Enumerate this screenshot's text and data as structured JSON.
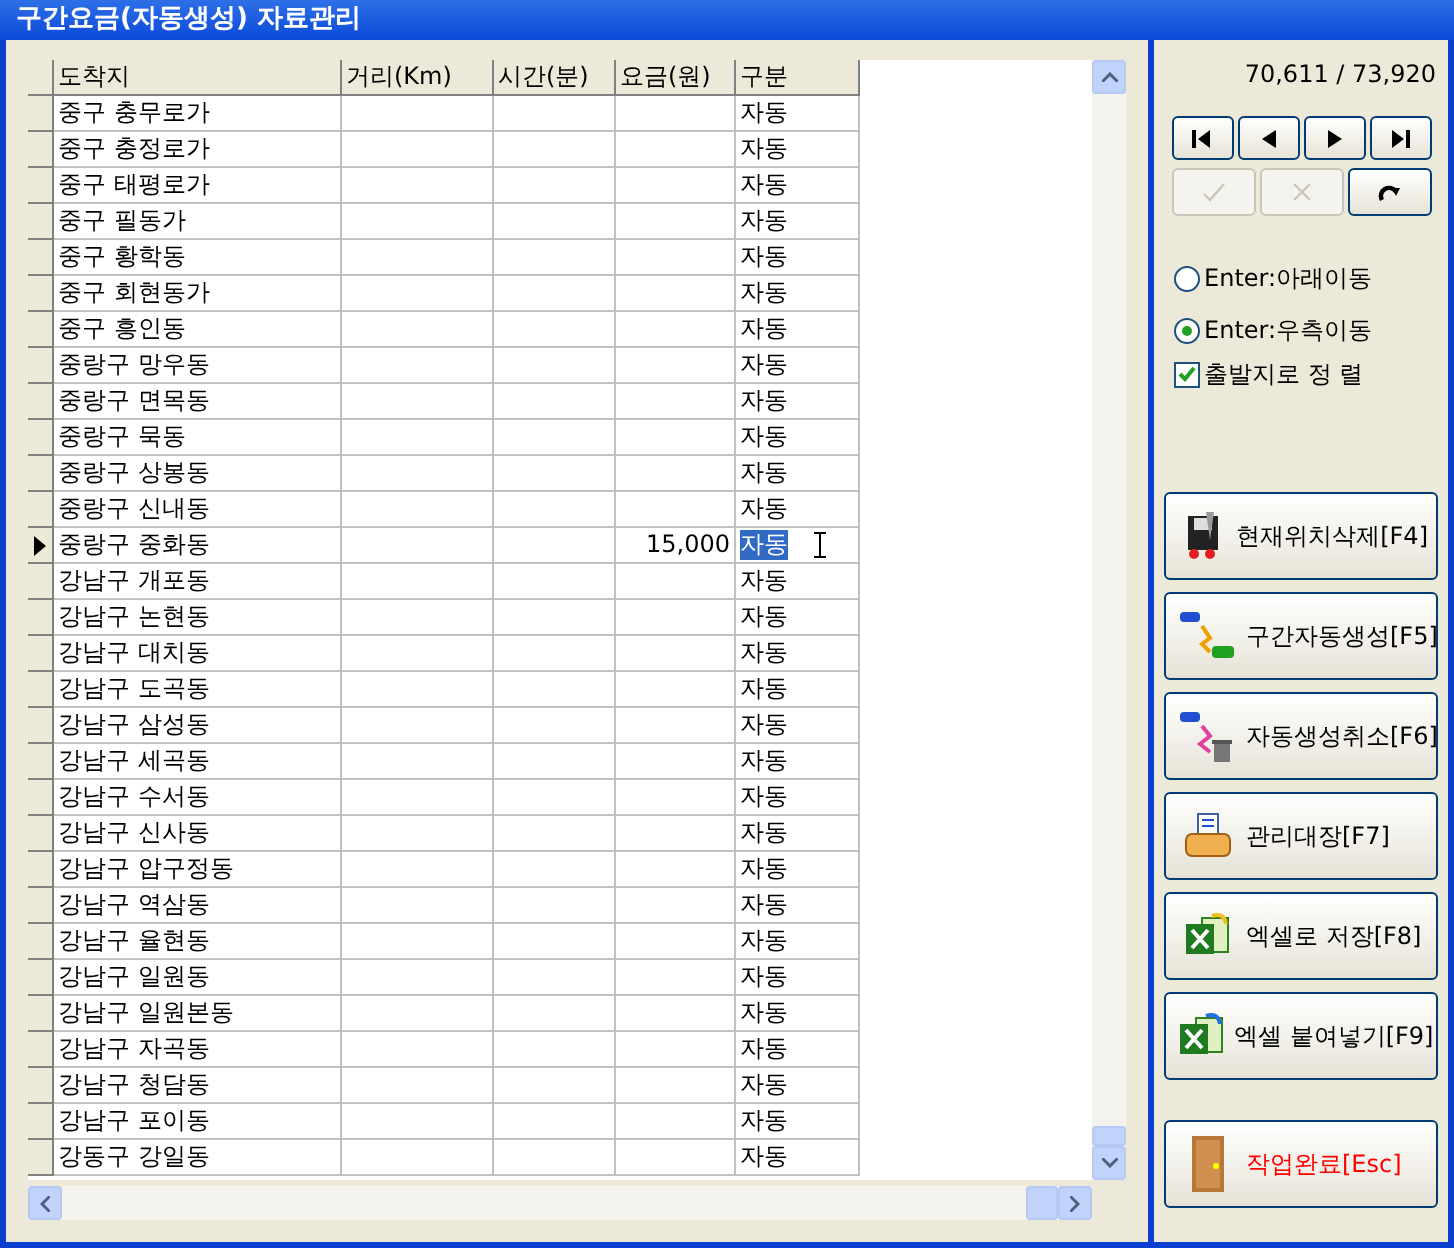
{
  "window": {
    "title": "구간요금(자동생성) 자료관리"
  },
  "table": {
    "columns": [
      "도착지",
      "거리(Km)",
      "시간(분)",
      "요금(원)",
      "구분"
    ],
    "rows": [
      {
        "cells": [
          "중구 충무로가",
          "",
          "",
          "",
          "자동"
        ],
        "selected": false
      },
      {
        "cells": [
          "중구 충정로가",
          "",
          "",
          "",
          "자동"
        ],
        "selected": false
      },
      {
        "cells": [
          "중구 태평로가",
          "",
          "",
          "",
          "자동"
        ],
        "selected": false
      },
      {
        "cells": [
          "중구 필동가",
          "",
          "",
          "",
          "자동"
        ],
        "selected": false
      },
      {
        "cells": [
          "중구 황학동",
          "",
          "",
          "",
          "자동"
        ],
        "selected": false
      },
      {
        "cells": [
          "중구 회현동가",
          "",
          "",
          "",
          "자동"
        ],
        "selected": false
      },
      {
        "cells": [
          "중구 흥인동",
          "",
          "",
          "",
          "자동"
        ],
        "selected": false
      },
      {
        "cells": [
          "중랑구 망우동",
          "",
          "",
          "",
          "자동"
        ],
        "selected": false
      },
      {
        "cells": [
          "중랑구 면목동",
          "",
          "",
          "",
          "자동"
        ],
        "selected": false
      },
      {
        "cells": [
          "중랑구 묵동",
          "",
          "",
          "",
          "자동"
        ],
        "selected": false
      },
      {
        "cells": [
          "중랑구 상봉동",
          "",
          "",
          "",
          "자동"
        ],
        "selected": false
      },
      {
        "cells": [
          "중랑구 신내동",
          "",
          "",
          "",
          "자동"
        ],
        "selected": false
      },
      {
        "cells": [
          "중랑구 중화동",
          "",
          "",
          "15,000",
          "자동"
        ],
        "selected": true
      },
      {
        "cells": [
          "강남구 개포동",
          "",
          "",
          "",
          "자동"
        ],
        "selected": false
      },
      {
        "cells": [
          "강남구 논현동",
          "",
          "",
          "",
          "자동"
        ],
        "selected": false
      },
      {
        "cells": [
          "강남구 대치동",
          "",
          "",
          "",
          "자동"
        ],
        "selected": false
      },
      {
        "cells": [
          "강남구 도곡동",
          "",
          "",
          "",
          "자동"
        ],
        "selected": false
      },
      {
        "cells": [
          "강남구 삼성동",
          "",
          "",
          "",
          "자동"
        ],
        "selected": false
      },
      {
        "cells": [
          "강남구 세곡동",
          "",
          "",
          "",
          "자동"
        ],
        "selected": false
      },
      {
        "cells": [
          "강남구 수서동",
          "",
          "",
          "",
          "자동"
        ],
        "selected": false
      },
      {
        "cells": [
          "강남구 신사동",
          "",
          "",
          "",
          "자동"
        ],
        "selected": false
      },
      {
        "cells": [
          "강남구 압구정동",
          "",
          "",
          "",
          "자동"
        ],
        "selected": false
      },
      {
        "cells": [
          "강남구 역삼동",
          "",
          "",
          "",
          "자동"
        ],
        "selected": false
      },
      {
        "cells": [
          "강남구 율현동",
          "",
          "",
          "",
          "자동"
        ],
        "selected": false
      },
      {
        "cells": [
          "강남구 일원동",
          "",
          "",
          "",
          "자동"
        ],
        "selected": false
      },
      {
        "cells": [
          "강남구 일원본동",
          "",
          "",
          "",
          "자동"
        ],
        "selected": false
      },
      {
        "cells": [
          "강남구 자곡동",
          "",
          "",
          "",
          "자동"
        ],
        "selected": false
      },
      {
        "cells": [
          "강남구 청담동",
          "",
          "",
          "",
          "자동"
        ],
        "selected": false
      },
      {
        "cells": [
          "강남구 포이동",
          "",
          "",
          "",
          "자동"
        ],
        "selected": false
      },
      {
        "cells": [
          "강동구 강일동",
          "",
          "",
          "",
          "자동"
        ],
        "selected": false
      }
    ]
  },
  "record_count": "70,611 / 73,920",
  "nav_buttons": [
    {
      "kind": "first",
      "disabled": false
    },
    {
      "kind": "prev",
      "disabled": false
    },
    {
      "kind": "next",
      "disabled": false
    },
    {
      "kind": "last",
      "disabled": false
    },
    {
      "kind": "post",
      "disabled": true
    },
    {
      "kind": "cancel",
      "disabled": true
    },
    {
      "kind": "refresh",
      "disabled": false
    }
  ],
  "enter_options": [
    {
      "label": "Enter:아래이동",
      "selected": false
    },
    {
      "label": "Enter:우측이동",
      "selected": true
    }
  ],
  "sort_by_origin": {
    "label": "출발지로 정 렬",
    "checked": true
  },
  "actions": [
    {
      "kind": "delete",
      "label": "현재위치삭제[F4]"
    },
    {
      "kind": "generate",
      "label": "구간자동생성[F5]"
    },
    {
      "kind": "undo",
      "label": "자동생성취소[F6]"
    },
    {
      "kind": "ledger",
      "label": "관리대장[F7]"
    },
    {
      "kind": "excel",
      "label": "엑셀로 저장[F8]"
    },
    {
      "kind": "paste",
      "label": "엑셀 붙여넣기[F9]"
    }
  ],
  "finish": {
    "kind": "exit",
    "label": "작업완료[Esc]"
  }
}
